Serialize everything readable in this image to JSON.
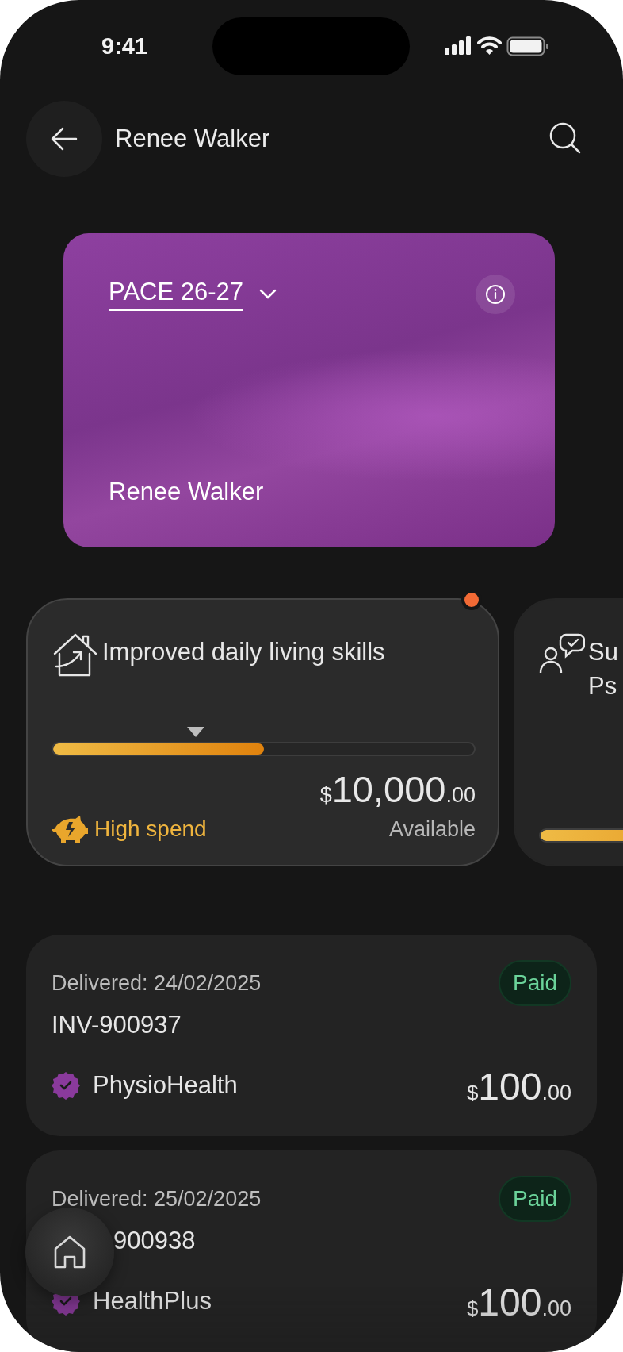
{
  "status_bar": {
    "time": "9:41"
  },
  "header": {
    "title": "Renee Walker"
  },
  "plan_card": {
    "plan": "PACE 26-27",
    "holder": "Renee Walker"
  },
  "goals": [
    {
      "kind": "house",
      "title_lines": [
        "Improved daily living skills"
      ],
      "alert": true,
      "level": 0.5,
      "marker": {
        "level": 0.34
      },
      "currency": "$",
      "amount": "10,000",
      "cents": ".00",
      "caption": "Available",
      "status": "High spend"
    },
    {
      "kind": "people",
      "title_lines": [
        "Su",
        "Ps"
      ],
      "alert": false,
      "level": 0.6
    }
  ],
  "invoices": [
    {
      "delivered": "Delivered: 24/02/2025",
      "status": "Paid",
      "number": "INV-900937",
      "provider": "PhysioHealth",
      "currency": "$",
      "amount": "100",
      "cents": ".00"
    },
    {
      "delivered": "Delivered: 25/02/2025",
      "status": "Paid",
      "number": "900938",
      "provider": "HealthPlus",
      "currency": "$",
      "amount": "100",
      "cents": ".00"
    }
  ]
}
